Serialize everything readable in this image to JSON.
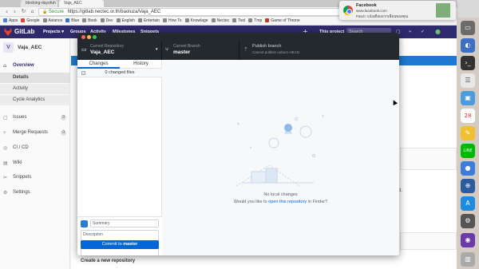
{
  "browser": {
    "tabs": [
      "blocking-dayofuh",
      "Vaja_AEC"
    ],
    "secure_label": "Secure",
    "url": "https://gitlab.nectec.or.th/baoluza/Vaja_AEC",
    "bookmarks": [
      {
        "label": "Apps",
        "color": "#4a7fd4"
      },
      {
        "label": "Google",
        "color": "#db4437"
      },
      {
        "label": "Aviance",
        "color": "#888888"
      },
      {
        "label": "Blue",
        "color": "#3a6fc8"
      },
      {
        "label": "Book",
        "color": "#888888"
      },
      {
        "label": "Dev",
        "color": "#888888"
      },
      {
        "label": "English",
        "color": "#888888"
      },
      {
        "label": "Entertain",
        "color": "#888888"
      },
      {
        "label": "How To",
        "color": "#888888"
      },
      {
        "label": "Knowlage",
        "color": "#888888"
      },
      {
        "label": "Nectec",
        "color": "#888888"
      },
      {
        "label": "Tool",
        "color": "#888888"
      },
      {
        "label": "Tmp",
        "color": "#888888"
      },
      {
        "label": "Game of Throne",
        "color": "#c0392b"
      }
    ]
  },
  "gitlab": {
    "title": "GitLab",
    "nav": [
      "Projects ▾",
      "Groups",
      "Activity",
      "Milestones",
      "Snippets"
    ],
    "scope": "This project",
    "search_placeholder": "Search",
    "project_initial": "V",
    "project_name": "Vaja_AEC",
    "sidebar": [
      {
        "label": "Overview",
        "icon": "home-icon",
        "glyph": "⌂",
        "count": ""
      },
      {
        "label": "Details",
        "sub": true,
        "selected": true
      },
      {
        "label": "Activity",
        "sub": true
      },
      {
        "label": "Cycle Analytics",
        "sub": true
      },
      {
        "label": "Issues",
        "icon": "issues-icon",
        "glyph": "▢",
        "count": "0"
      },
      {
        "label": "Merge Requests",
        "icon": "merge-icon",
        "glyph": "⑂",
        "count": "0"
      },
      {
        "label": "CI / CD",
        "icon": "ci-icon",
        "glyph": "◎",
        "count": ""
      },
      {
        "label": "Wiki",
        "icon": "book-icon",
        "glyph": "▤",
        "count": ""
      },
      {
        "label": "Snippets",
        "icon": "snippet-icon",
        "glyph": "✂",
        "count": ""
      },
      {
        "label": "Settings",
        "icon": "gear-icon",
        "glyph": "⚙",
        "count": ""
      }
    ],
    "hint_fragment": "cted.",
    "bottom_heading": "Create a new repository"
  },
  "desktop": {
    "repo_label": "Current Repository",
    "repo_value": "Vaja_AEC",
    "branch_label": "Current Branch",
    "branch_value": "master",
    "publish_label": "Publish branch",
    "publish_sub": "Cannot publish unborn HEAD",
    "tabs": [
      "Changes",
      "History"
    ],
    "changed_files": "0 changed files",
    "summary_placeholder": "Summary",
    "description_placeholder": "Description",
    "commit_prefix": "Commit to ",
    "commit_branch": "master",
    "empty_title": "No local changes",
    "empty_prefix": "Would you like to ",
    "empty_link": "open this repository",
    "empty_suffix": " in Finder?"
  },
  "notification": {
    "app": "Facebook",
    "site": "www.facebook.com",
    "message": "Patch: แจ้งเตือนจากเพื่อนของคุณ"
  },
  "colors": {
    "gitlab_nav": "#2f2a6b",
    "desktop_dark": "#24292e",
    "accent_blue": "#0366d6"
  }
}
